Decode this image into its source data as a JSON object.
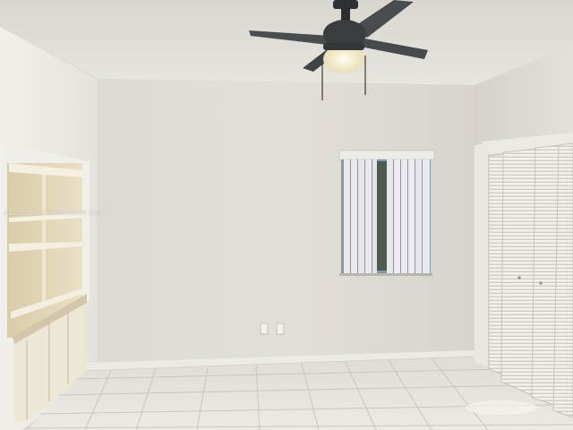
{
  "image": {
    "caption_watermark": "A11786370 © Miami MLS® 2025"
  },
  "palette": {
    "ceiling": "#e4e2dc",
    "back_wall": "#dedbd3",
    "left_wall": "#e8e6e1",
    "right_wall": "#dcd9d2",
    "floor_tile": "#e7e5e0",
    "grout": "#c9c6bf",
    "shelf_wood": "#e7dcc0",
    "closet_door": "#f3f2ee",
    "fan_body": "#3a3d3f",
    "fan_light": "#f6f1d6",
    "window_glass": "#7f9aa8"
  }
}
